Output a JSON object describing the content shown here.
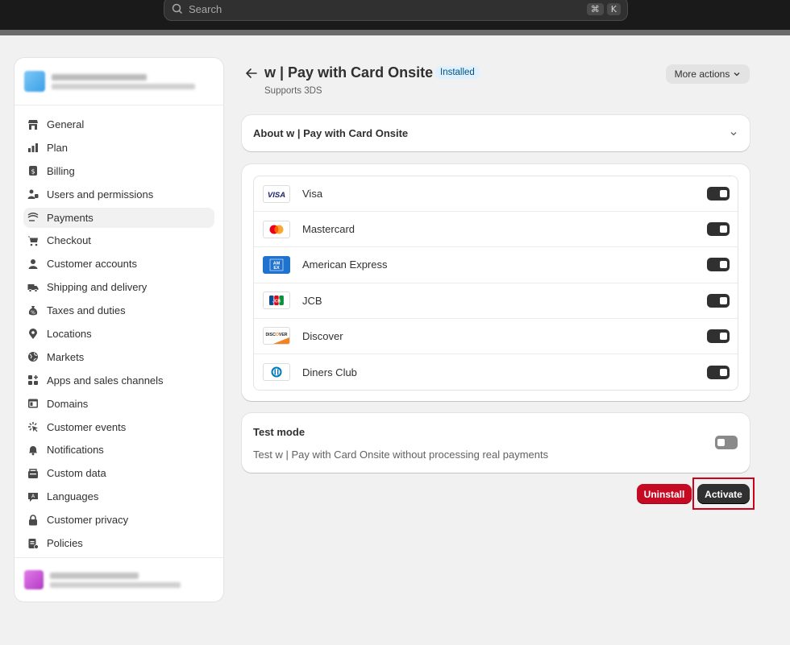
{
  "search": {
    "placeholder": "Search",
    "shortcut_cmd": "⌘",
    "shortcut_key": "K"
  },
  "sidebar": {
    "items": [
      {
        "label": "General",
        "icon": "store-icon"
      },
      {
        "label": "Plan",
        "icon": "plan-icon"
      },
      {
        "label": "Billing",
        "icon": "billing-icon"
      },
      {
        "label": "Users and permissions",
        "icon": "users-icon"
      },
      {
        "label": "Payments",
        "icon": "payments-icon",
        "active": true
      },
      {
        "label": "Checkout",
        "icon": "cart-icon"
      },
      {
        "label": "Customer accounts",
        "icon": "person-icon"
      },
      {
        "label": "Shipping and delivery",
        "icon": "truck-icon"
      },
      {
        "label": "Taxes and duties",
        "icon": "tax-icon"
      },
      {
        "label": "Locations",
        "icon": "location-icon"
      },
      {
        "label": "Markets",
        "icon": "globe-icon"
      },
      {
        "label": "Apps and sales channels",
        "icon": "apps-icon"
      },
      {
        "label": "Domains",
        "icon": "domain-icon"
      },
      {
        "label": "Customer events",
        "icon": "events-icon"
      },
      {
        "label": "Notifications",
        "icon": "bell-icon"
      },
      {
        "label": "Custom data",
        "icon": "data-icon"
      },
      {
        "label": "Languages",
        "icon": "language-icon"
      },
      {
        "label": "Customer privacy",
        "icon": "lock-icon"
      },
      {
        "label": "Policies",
        "icon": "policy-icon"
      }
    ]
  },
  "header": {
    "title": "w | Pay with Card Onsite",
    "badge": "Installed",
    "subtitle": "Supports 3DS",
    "more_actions": "More actions"
  },
  "about": {
    "title": "About w | Pay with Card Onsite"
  },
  "methods": [
    {
      "name": "Visa",
      "logo": "visa-logo",
      "enabled": true
    },
    {
      "name": "Mastercard",
      "logo": "mastercard-logo",
      "enabled": true
    },
    {
      "name": "American Express",
      "logo": "amex-logo",
      "enabled": true
    },
    {
      "name": "JCB",
      "logo": "jcb-logo",
      "enabled": true
    },
    {
      "name": "Discover",
      "logo": "discover-logo",
      "enabled": true
    },
    {
      "name": "Diners Club",
      "logo": "diners-logo",
      "enabled": true
    }
  ],
  "test_mode": {
    "title": "Test mode",
    "description": "Test w | Pay with Card Onsite without processing real payments",
    "enabled": false
  },
  "actions": {
    "uninstall": "Uninstall",
    "activate": "Activate"
  },
  "colors": {
    "uninstall": "#c70a24",
    "activate": "#303030",
    "highlight": "#d0021b",
    "badge_bg": "#e0f0ff"
  }
}
